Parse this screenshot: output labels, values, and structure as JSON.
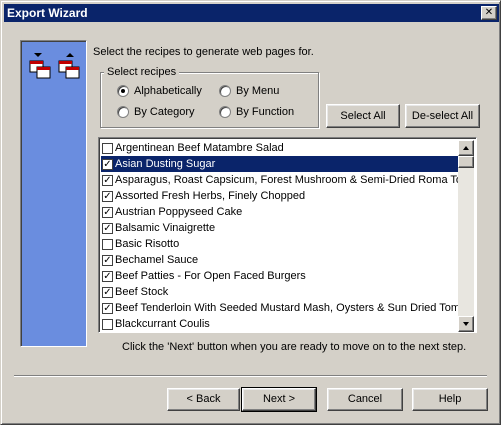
{
  "window": {
    "title": "Export Wizard",
    "close_glyph": "✕"
  },
  "instructions": "Select the recipes to generate web pages for.",
  "group": {
    "label": "Select recipes",
    "options": [
      {
        "label": "Alphabetically",
        "selected": true
      },
      {
        "label": "By Menu",
        "selected": false
      },
      {
        "label": "By Category",
        "selected": false
      },
      {
        "label": "By Function",
        "selected": false
      }
    ]
  },
  "buttons": {
    "select_all": "Select All",
    "deselect_all": "De-select All",
    "back": "< Back",
    "next": "Next >",
    "cancel": "Cancel",
    "help": "Help"
  },
  "recipes": [
    {
      "name": "Argentinean Beef Matambre Salad",
      "checked": false,
      "selected": false
    },
    {
      "name": "Asian Dusting Sugar",
      "checked": true,
      "selected": true
    },
    {
      "name": "Asparagus, Roast Capsicum, Forest Mushroom & Semi-Dried Roma Tomat",
      "checked": true,
      "selected": false
    },
    {
      "name": "Assorted Fresh Herbs, Finely Chopped",
      "checked": true,
      "selected": false
    },
    {
      "name": "Austrian Poppyseed Cake",
      "checked": true,
      "selected": false
    },
    {
      "name": "Balsamic Vinaigrette",
      "checked": true,
      "selected": false
    },
    {
      "name": "Basic Risotto",
      "checked": false,
      "selected": false
    },
    {
      "name": "Bechamel Sauce",
      "checked": true,
      "selected": false
    },
    {
      "name": "Beef Patties - For Open Faced Burgers",
      "checked": true,
      "selected": false
    },
    {
      "name": "Beef Stock",
      "checked": true,
      "selected": false
    },
    {
      "name": "Beef Tenderloin With Seeded Mustard Mash, Oysters &  Sun Dried Tomato",
      "checked": true,
      "selected": false
    },
    {
      "name": "Blackcurrant Coulis",
      "checked": false,
      "selected": false
    }
  ],
  "footer_note": "Click the 'Next' button when you are ready to move on to the next step.",
  "colors": {
    "titlebar": "#0a246a",
    "sidepanel": "#6a8ddf",
    "dialog_bg": "#d4d0c8",
    "selection": "#0a246a"
  },
  "icons": [
    "export-pages-icon",
    "import-pages-icon",
    "check-icon",
    "scroll-up-arrow-icon",
    "scroll-down-arrow-icon",
    "close-icon"
  ]
}
